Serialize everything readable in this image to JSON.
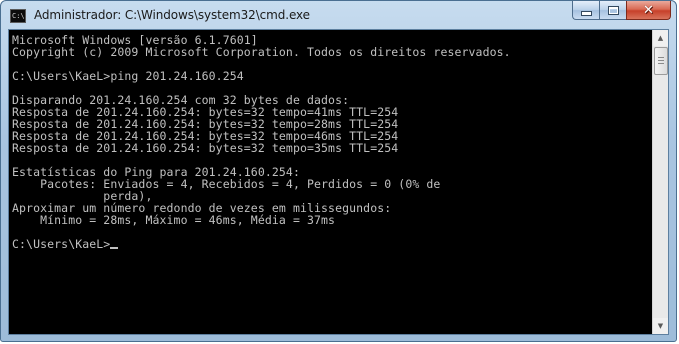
{
  "window": {
    "title": "Administrador: C:\\Windows\\system32\\cmd.exe",
    "icon": "cmd-console-icon",
    "icon_text": "C:\\.",
    "buttons": {
      "minimize": "minimize-icon",
      "maximize": "maximize-icon",
      "close": "close-icon",
      "close_glyph": "✕"
    }
  },
  "console": {
    "text_color": "#c0c0c0",
    "background": "#000000",
    "lines": [
      "Microsoft Windows [versão 6.1.7601]",
      "Copyright (c) 2009 Microsoft Corporation. Todos os direitos reservados.",
      "",
      "C:\\Users\\KaeL>ping 201.24.160.254",
      "",
      "Disparando 201.24.160.254 com 32 bytes de dados:",
      "Resposta de 201.24.160.254: bytes=32 tempo=41ms TTL=254",
      "Resposta de 201.24.160.254: bytes=32 tempo=28ms TTL=254",
      "Resposta de 201.24.160.254: bytes=32 tempo=46ms TTL=254",
      "Resposta de 201.24.160.254: bytes=32 tempo=35ms TTL=254",
      "",
      "Estatísticas do Ping para 201.24.160.254:",
      "    Pacotes: Enviados = 4, Recebidos = 4, Perdidos = 0 (0% de",
      "             perda),",
      "Aproximar um número redondo de vezes em milissegundos:",
      "    Mínimo = 28ms, Máximo = 46ms, Média = 37ms",
      "",
      "C:\\Users\\KaeL>"
    ]
  },
  "scrollbar": {
    "up_arrow": "▲",
    "down_arrow": "▼"
  }
}
